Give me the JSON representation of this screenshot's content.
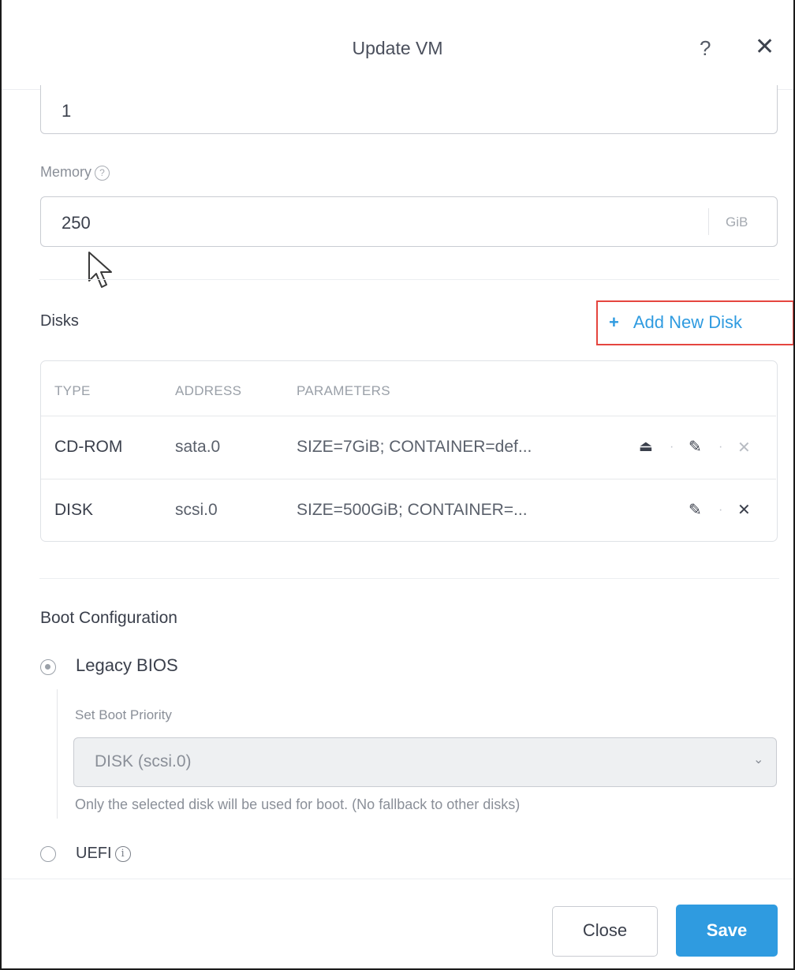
{
  "dialog": {
    "title": "Update VM",
    "help_icon": "question-mark-icon",
    "close_icon": "close-x-icon"
  },
  "form": {
    "vcpu_value": "1",
    "memory_label": "Memory",
    "memory_help_icon": "question-circle-icon",
    "memory_value": "250",
    "memory_unit": "GiB"
  },
  "disks": {
    "title": "Disks",
    "add_button_label": "Add New Disk",
    "add_button_icon": "plus-icon",
    "headers": [
      "TYPE",
      "ADDRESS",
      "PARAMETERS"
    ],
    "rows": [
      {
        "type": "CD-ROM",
        "address": "sata.0",
        "parameters": "SIZE=7GiB; CONTAINER=def...",
        "actions": [
          "eject-icon",
          "edit-pencil-icon",
          "delete-x-icon"
        ]
      },
      {
        "type": "DISK",
        "address": "scsi.0",
        "parameters": "SIZE=500GiB; CONTAINER=...",
        "actions": [
          "edit-pencil-icon",
          "delete-x-icon"
        ]
      }
    ]
  },
  "boot": {
    "title": "Boot Configuration",
    "legacy_label": "Legacy BIOS",
    "legacy_selected": true,
    "priority_label": "Set Boot Priority",
    "priority_value": "DISK (scsi.0)",
    "priority_hint": "Only the selected disk will be used for boot. (No fallback to other disks)",
    "uefi_label": "UEFI",
    "uefi_selected": false,
    "uefi_info_icon": "info-circle-icon"
  },
  "footer": {
    "close_label": "Close",
    "save_label": "Save"
  },
  "colors": {
    "accent": "#2f9be0",
    "highlight_border": "#e5453f"
  }
}
